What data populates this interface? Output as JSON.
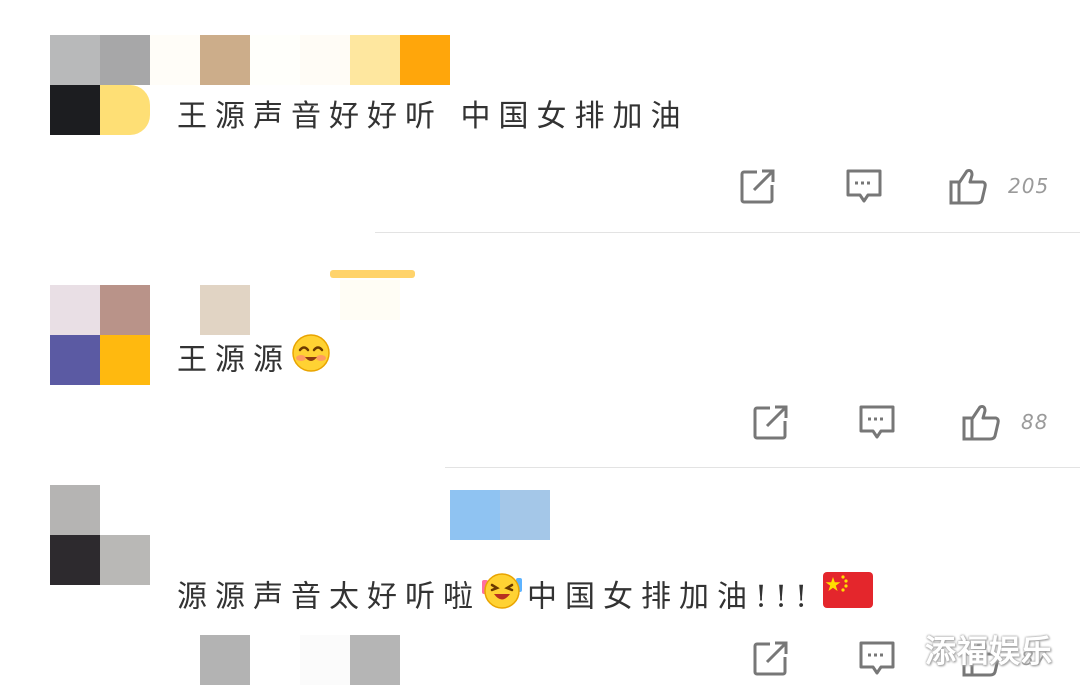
{
  "comments": [
    {
      "text": "王源声音好好听 中国女排加油",
      "like_count": "205",
      "actions": {
        "share_icon": "share-external-icon",
        "reply_icon": "comment-bubble-icon",
        "like_icon": "thumbs-up-icon"
      }
    },
    {
      "text": "王源源",
      "emoji": "blush-smile-emoji",
      "like_count": "88",
      "actions": {
        "share_icon": "share-external-icon",
        "reply_icon": "comment-bubble-icon",
        "like_icon": "thumbs-up-icon"
      }
    },
    {
      "text_before": "源源声音太好听啦",
      "emoji": "excited-laugh-emoji",
      "text_after": "中国女排加油!!!",
      "flag_emoji": "china-flag-emoji",
      "like_count": "87",
      "actions": {
        "share_icon": "share-external-icon",
        "reply_icon": "comment-bubble-icon",
        "like_icon": "thumbs-up-icon"
      }
    }
  ],
  "watermark": "添福娱乐",
  "colors": {
    "icon": "#777777",
    "text": "#333333",
    "count": "#9a9a9a",
    "divider": "#e3e3e3"
  }
}
